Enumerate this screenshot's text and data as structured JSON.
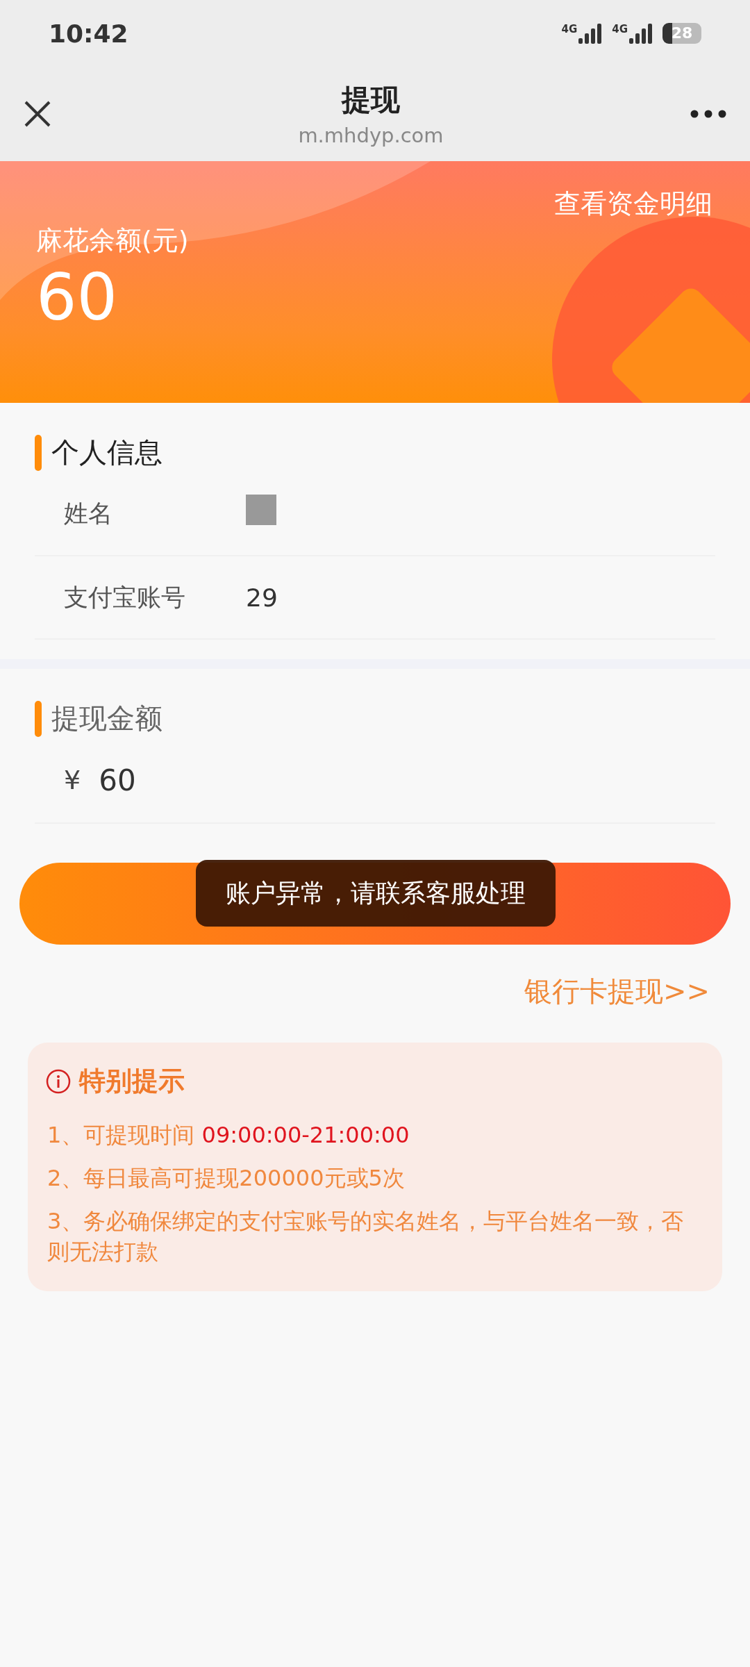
{
  "status_bar": {
    "time": "10:42",
    "networks": [
      "4G",
      "4G"
    ],
    "battery": "28"
  },
  "header": {
    "title": "提现",
    "url": "m.mhdyp.com"
  },
  "balance": {
    "details_link": "查看资金明细",
    "label": "麻花余额(元)",
    "amount": "60"
  },
  "personal_info": {
    "title": "个人信息",
    "rows": [
      {
        "label": "姓名",
        "kind": "redacted"
      },
      {
        "label": "支付宝账号",
        "kind": "text",
        "value": "29"
      }
    ]
  },
  "withdraw": {
    "title": "提现金额",
    "currency": "¥",
    "amount": "60"
  },
  "toast": "账户异常，请联系客服处理",
  "bank_link": "银行卡提现>>",
  "tips": {
    "title": "特别提示",
    "items": [
      {
        "text": "1、可提现时间 ",
        "highlight": "09:00:00-21:00:00"
      },
      {
        "text": "2、每日最高可提现200000元或5次"
      },
      {
        "text": "3、务必确保绑定的支付宝账号的实名姓名，与平台姓名一致，否则无法打款"
      }
    ]
  }
}
